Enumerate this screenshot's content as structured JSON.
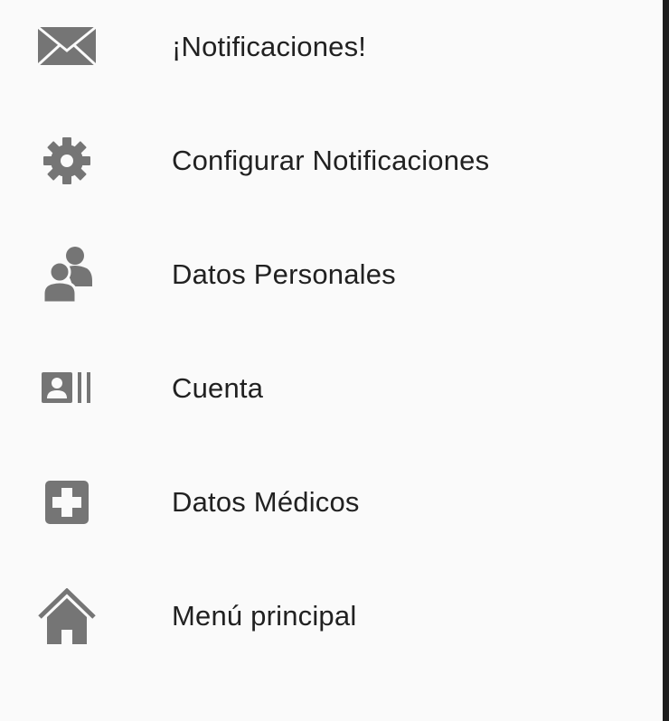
{
  "menu": {
    "items": [
      {
        "id": "notificaciones",
        "label": "¡Notificaciones!",
        "icon": "envelope-icon"
      },
      {
        "id": "configurar",
        "label": "Configurar Notificaciones",
        "icon": "gear-icon"
      },
      {
        "id": "datos-personales",
        "label": "Datos Personales",
        "icon": "users-icon"
      },
      {
        "id": "cuenta",
        "label": "Cuenta",
        "icon": "id-card-icon"
      },
      {
        "id": "datos-medicos",
        "label": "Datos Médicos",
        "icon": "medical-cross-icon"
      },
      {
        "id": "menu-principal",
        "label": "Menú principal",
        "icon": "home-icon"
      }
    ]
  },
  "colors": {
    "background": "#fafafa",
    "icon": "#757575",
    "text": "#212121",
    "scrim": "#1e1e1e"
  }
}
